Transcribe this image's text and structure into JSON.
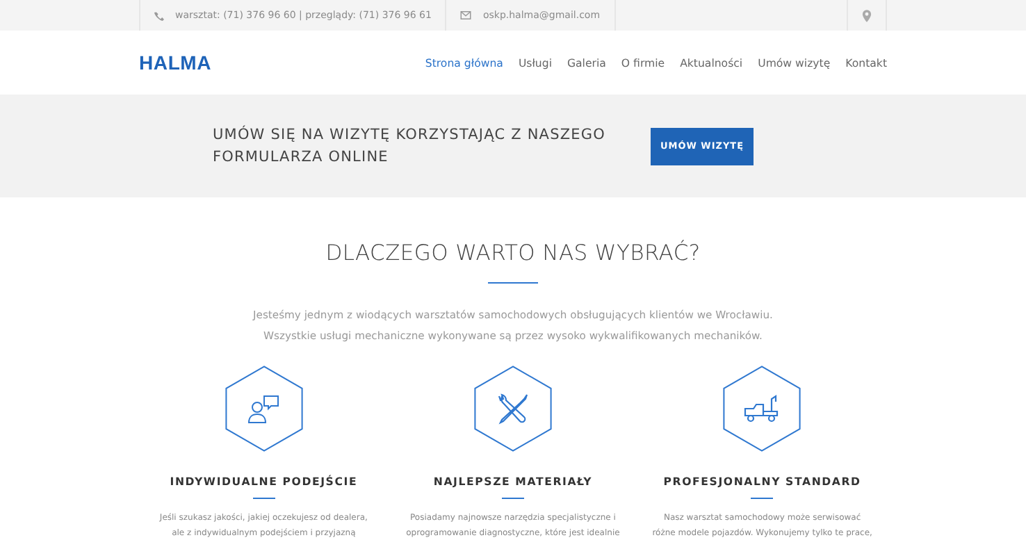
{
  "topbar": {
    "phone": "warsztat: (71) 376 96 60 | przeglądy: (71) 376 96 61",
    "email": "oskp.halma@gmail.com"
  },
  "header": {
    "logo": "HALMA",
    "nav": [
      {
        "label": "Strona główna",
        "selected": true
      },
      {
        "label": "Usługi",
        "selected": false
      },
      {
        "label": "Galeria",
        "selected": false
      },
      {
        "label": "O firmie",
        "selected": false
      },
      {
        "label": "Aktualności",
        "selected": false
      },
      {
        "label": "Umów wizytę",
        "selected": false
      },
      {
        "label": "Kontakt",
        "selected": false
      }
    ]
  },
  "banner": {
    "text": "UMÓW SIĘ NA WIZYTĘ KORZYSTAJĄC Z NASZEGO FORMULARZA ONLINE",
    "button": "UMÓW WIZYTĘ"
  },
  "section": {
    "title": "DLACZEGO WARTO NAS WYBRAĆ?",
    "intro": [
      "Jesteśmy jednym z wiodących warsztatów samochodowych obsługujących klientów we Wrocławiu.",
      "Wszystkie usługi mechaniczne wykonywane są przez wysoko wykwalifikowanych mechaników."
    ],
    "features": [
      {
        "kind": "person",
        "title": "INDYWIDUALNE PODEJŚCIE",
        "text": [
          "Jeśli szukasz jakości, jakiej oczekujesz od dealera,",
          "ale z indywidualnym podejściem i przyjazną"
        ]
      },
      {
        "kind": "tools",
        "title": "NAJLEPSZE MATERIAŁY",
        "text": [
          "Posiadamy najnowsze narzędzia specjalistyczne i",
          "oprogramowanie diagnostyczne, które jest idealnie"
        ]
      },
      {
        "kind": "truck",
        "title": "PROFESJONALNY STANDARD",
        "text": [
          "Nasz warsztat samochodowy może serwisować",
          "różne modele pojazdów. Wykonujemy tylko te prace,"
        ]
      }
    ]
  }
}
